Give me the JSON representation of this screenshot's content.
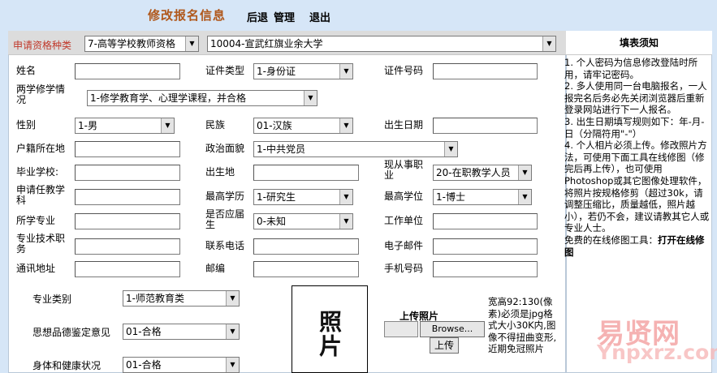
{
  "header": {
    "title": "修改报名信息",
    "links": [
      "后退",
      "管理",
      "退出"
    ]
  },
  "qualification": {
    "label": "申请资格种类",
    "type_value": "7-高等学校教师资格",
    "school_value": "10004-宣武红旗业余大学"
  },
  "form": {
    "name_label": "姓名",
    "id_type_label": "证件类型",
    "id_type_value": "1-身份证",
    "id_number_label": "证件号码",
    "study_label": "两学修学情况",
    "study_value": "1-修学教育学、心理学课程，并合格",
    "gender_label": "性别",
    "gender_value": "1-男",
    "ethnicity_label": "民族",
    "ethnicity_value": "01-汉族",
    "birthdate_label": "出生日期",
    "household_label": "户籍所在地",
    "political_label": "政治面貌",
    "political_value": "1-中共党员",
    "school_label": "毕业学校:",
    "birthplace_label": "出生地",
    "occupation_label": "现从事职业",
    "occupation_value": "20-在职教学人员",
    "subject_label": "申请任教学科",
    "education_label": "最高学历",
    "education_value": "1-研究生",
    "degree_label": "最高学位",
    "degree_value": "1-博士",
    "major_label": "所学专业",
    "fresh_grad_label": "是否应届生",
    "fresh_grad_value": "0-未知",
    "workplace_label": "工作单位",
    "title_label": "专业技术职务",
    "phone_label": "联系电话",
    "email_label": "电子邮件",
    "address_label": "通讯地址",
    "postcode_label": "邮编",
    "mobile_label": "手机号码",
    "category_label": "专业类别",
    "category_value": "1-师范教育类",
    "moral_label": "思想品德鉴定意见",
    "moral_value": "01-合格",
    "health_label": "身体和健康状况",
    "health_value": "01-合格"
  },
  "photo": {
    "placeholder": "照片",
    "upload_label": "上传照片",
    "browse_label": "Browse...",
    "upload_button": "上传",
    "notes": "宽高92:130(像素)必须是jpg格式大小30K内,图像不得扭曲变形,近期免冠照片"
  },
  "notice": {
    "title": "填表须知",
    "items": [
      "1. 个人密码为信息修改登陆时所用，请牢记密码。",
      "2. 多人使用同一台电脑报名，一人报完名后务必先关闭浏览器后重新登录网站进行下一人报名。",
      "3. 出生日期填写规则如下：年-月-日（分隔符用\"-\"）",
      "4. 个人相片必须上传。修改照片方法，可使用下面工具在线修图（修完后再上传），也可使用Photoshop或其它图像处理软件，将照片按规格修剪（超过30k，请调整压缩比，质量越低，照片越小），若仍不会，建议请教其它人或专业人士。"
    ],
    "tool_text": "免费的在线修图工具：",
    "tool_link": "打开在线修图"
  },
  "watermark": {
    "line1": "易贤网",
    "line2": "Ynpxrz.com"
  }
}
